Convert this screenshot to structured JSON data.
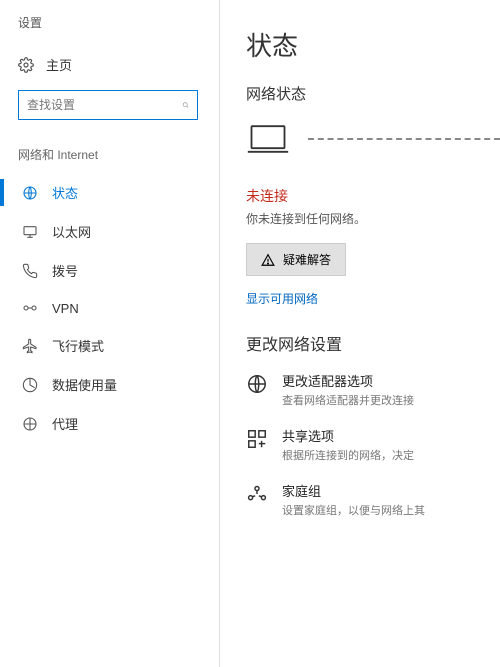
{
  "app": {
    "title": "设置"
  },
  "sidebar": {
    "home": "主页",
    "search_placeholder": "查找设置",
    "section": "网络和 Internet",
    "items": [
      {
        "label": "状态"
      },
      {
        "label": "以太网"
      },
      {
        "label": "拨号"
      },
      {
        "label": "VPN"
      },
      {
        "label": "飞行模式"
      },
      {
        "label": "数据使用量"
      },
      {
        "label": "代理"
      }
    ]
  },
  "main": {
    "title": "状态",
    "network_status_heading": "网络状态",
    "not_connected": "未连接",
    "not_connected_desc": "你未连接到任何网络。",
    "troubleshoot": "疑难解答",
    "show_available": "显示可用网络",
    "change_heading": "更改网络设置",
    "options": [
      {
        "title": "更改适配器选项",
        "desc": "查看网络适配器并更改连接"
      },
      {
        "title": "共享选项",
        "desc": "根据所连接到的网络，决定"
      },
      {
        "title": "家庭组",
        "desc": "设置家庭组，以便与网络上其"
      }
    ]
  }
}
